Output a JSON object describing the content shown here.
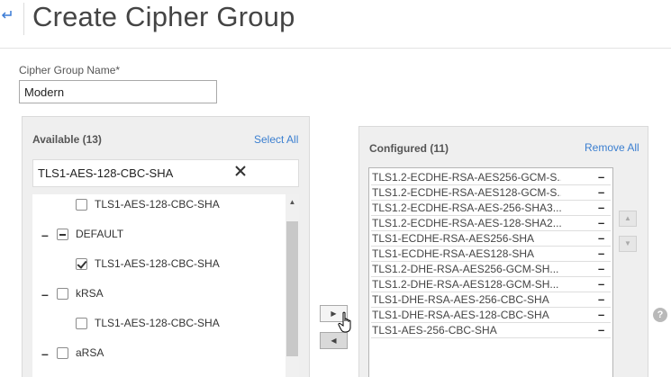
{
  "header": {
    "back_icon": "back-arrow-icon",
    "title": "Create Cipher Group"
  },
  "form": {
    "name_label": "Cipher Group Name*",
    "name_value": "Modern"
  },
  "available": {
    "title": "Available (13)",
    "select_all": "Select All",
    "search_value": "TLS1-AES-128-CBC-SHA",
    "clear_icon": "close-icon",
    "tree": [
      {
        "label": "TLS1-AES-128-CBC-SHA",
        "level": 1,
        "state": "unchecked"
      },
      {
        "label": "DEFAULT",
        "level": 0,
        "state": "partial",
        "expanded": true
      },
      {
        "label": "TLS1-AES-128-CBC-SHA",
        "level": 1,
        "state": "checked"
      },
      {
        "label": "kRSA",
        "level": 0,
        "state": "unchecked",
        "expanded": true
      },
      {
        "label": "TLS1-AES-128-CBC-SHA",
        "level": 1,
        "state": "unchecked"
      },
      {
        "label": "aRSA",
        "level": 0,
        "state": "unchecked",
        "expanded": true
      },
      {
        "label": "",
        "level": 1,
        "state": "unchecked"
      }
    ],
    "tree_dash": "–"
  },
  "transfer": {
    "move_right_icon": "triangle-right-icon",
    "move_left_icon": "triangle-left-icon"
  },
  "configured": {
    "title": "Configured (11)",
    "remove_all": "Remove All",
    "remove_glyph": "–",
    "items": [
      "TLS1.2-ECDHE-RSA-AES256-GCM-S...",
      "TLS1.2-ECDHE-RSA-AES128-GCM-S...",
      "TLS1.2-ECDHE-RSA-AES-256-SHA3...",
      "TLS1.2-ECDHE-RSA-AES-128-SHA2...",
      "TLS1-ECDHE-RSA-AES256-SHA",
      "TLS1-ECDHE-RSA-AES128-SHA",
      "TLS1.2-DHE-RSA-AES256-GCM-SH...",
      "TLS1.2-DHE-RSA-AES128-GCM-SH...",
      "TLS1-DHE-RSA-AES-256-CBC-SHA",
      "TLS1-DHE-RSA-AES-128-CBC-SHA",
      "TLS1-AES-256-CBC-SHA"
    ]
  },
  "help": {
    "glyph": "?"
  },
  "colors": {
    "link": "#3b7fd0",
    "panel_bg": "#efefef"
  }
}
